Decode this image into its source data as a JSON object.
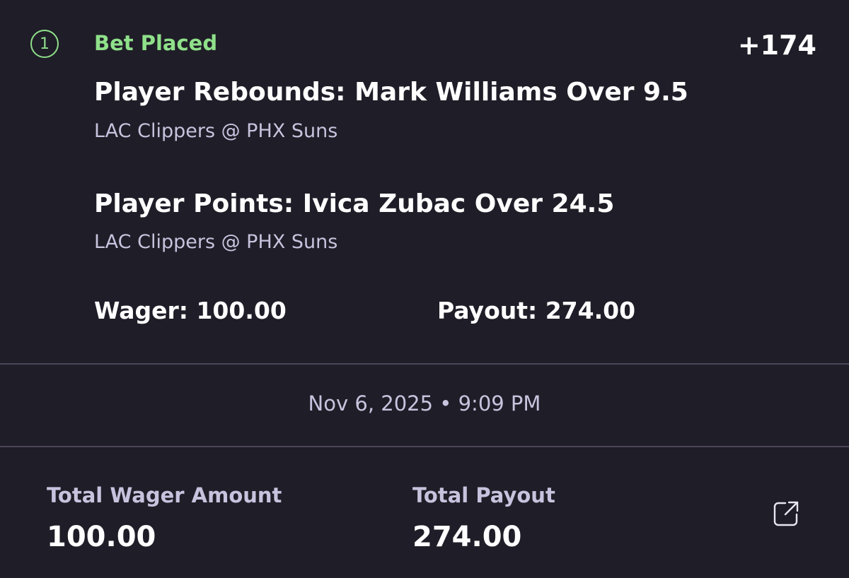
{
  "bet": {
    "leg_number": "1",
    "status": "Bet Placed",
    "odds": "+174",
    "picks": [
      {
        "title": "Player Rebounds: Mark Williams Over 9.5",
        "matchup": "LAC Clippers @ PHX Suns"
      },
      {
        "title": "Player Points: Ivica Zubac Over 24.5",
        "matchup": "LAC Clippers @ PHX Suns"
      }
    ],
    "wager_text": "Wager: 100.00",
    "payout_text": "Payout: 274.00"
  },
  "timestamp": "Nov 6, 2025 • 9:09 PM",
  "totals": {
    "wager_label": "Total Wager Amount",
    "wager_value": "100.00",
    "payout_label": "Total Payout",
    "payout_value": "274.00"
  },
  "icons": {
    "share": "share-external-icon"
  },
  "colors": {
    "background": "#1f1d27",
    "accent_green": "#8fe08a",
    "muted_text": "#c7c3de",
    "divider": "#4a4658"
  }
}
